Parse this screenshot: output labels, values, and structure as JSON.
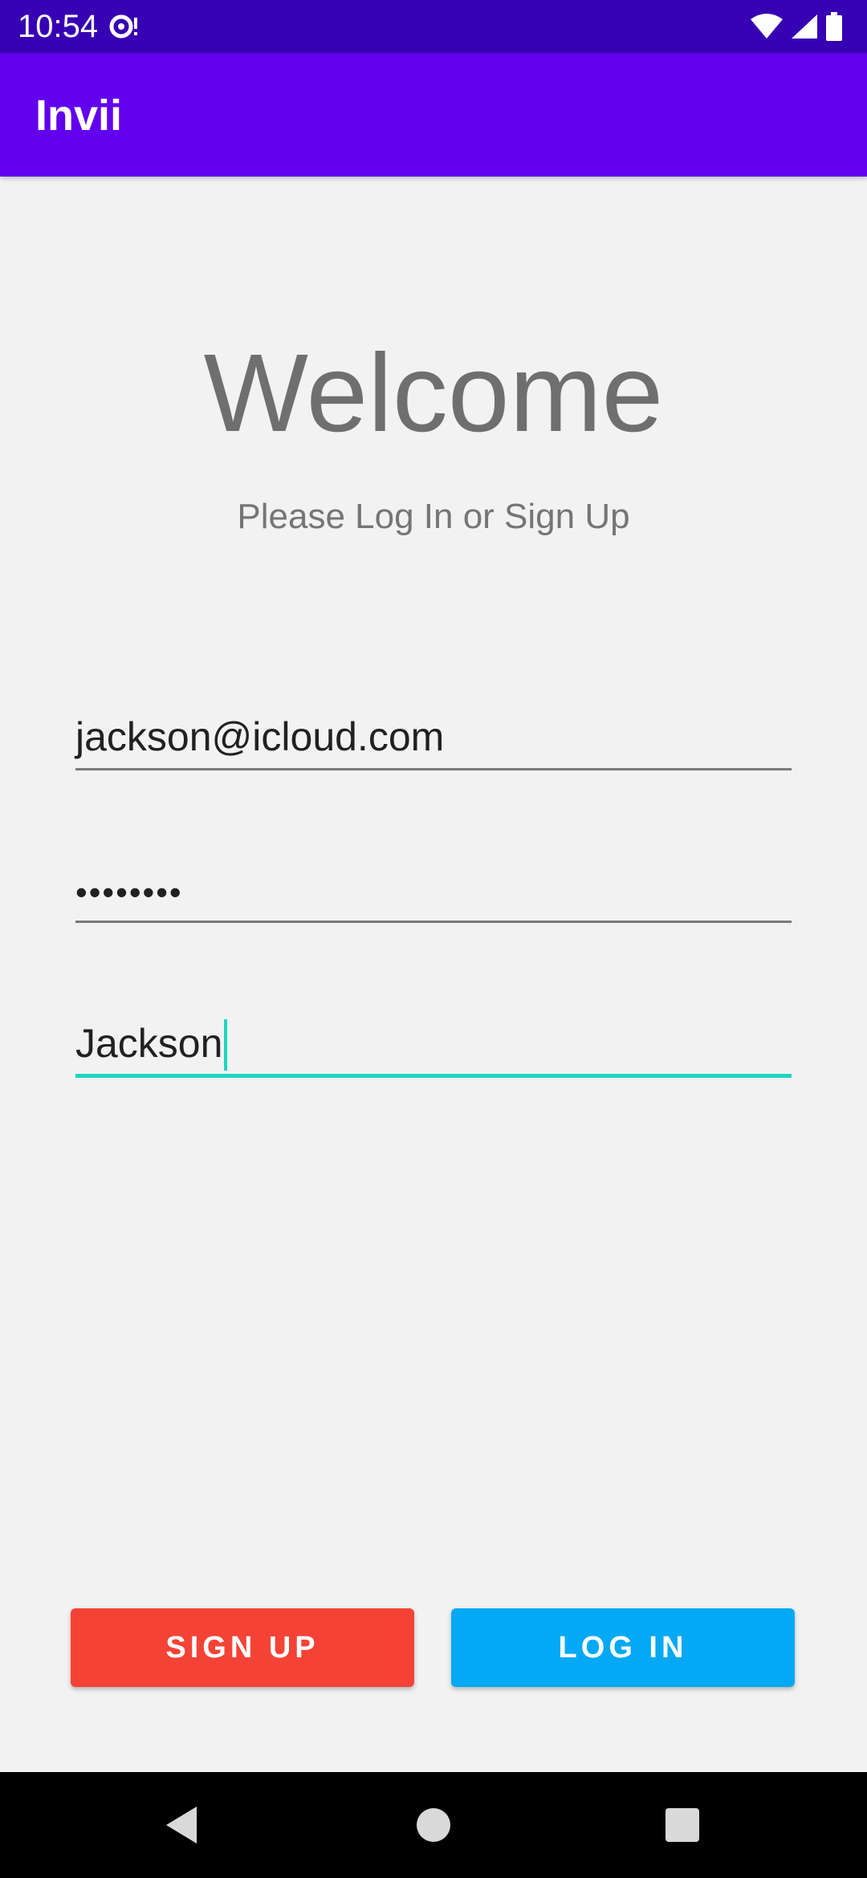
{
  "status_bar": {
    "time": "10:54",
    "icons": [
      "notification-icon",
      "wifi-icon",
      "signal-icon",
      "battery-icon"
    ]
  },
  "app_bar": {
    "title": "Invii",
    "color": "#6200ee"
  },
  "main": {
    "heading": "Welcome",
    "subtitle": "Please Log In or Sign Up",
    "email": {
      "value": "jackson@icloud.com"
    },
    "password": {
      "value": "••••••••"
    },
    "name": {
      "value": "Jackson"
    }
  },
  "actions": {
    "sign_up_label": "SIGN UP",
    "log_in_label": "LOG IN",
    "sign_up_color": "#f44336",
    "log_in_color": "#03a9f4"
  },
  "nav_bar": {
    "icons": [
      "back-icon",
      "home-icon",
      "recents-icon"
    ]
  }
}
